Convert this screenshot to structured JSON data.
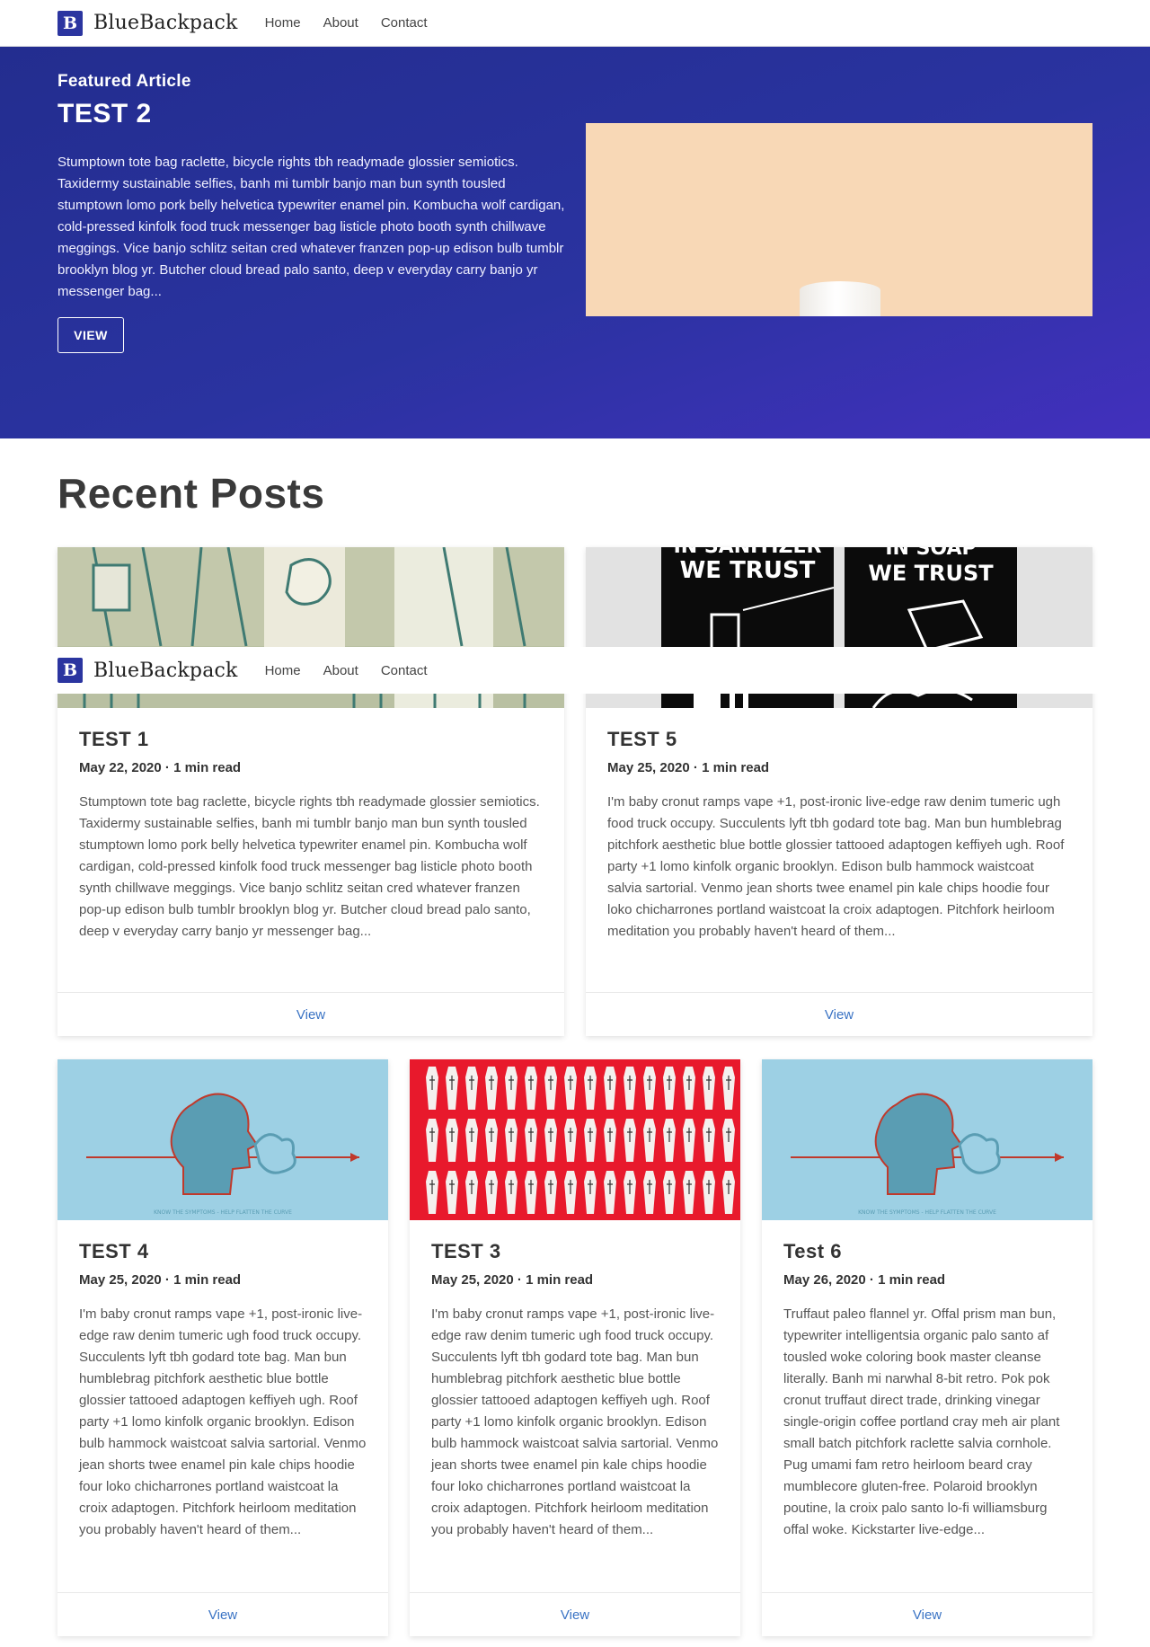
{
  "nav": {
    "logo_letter": "B",
    "brand": "BlueBackpack",
    "links": [
      "Home",
      "About",
      "Contact"
    ]
  },
  "hero": {
    "kicker": "Featured Article",
    "title": "TEST 2",
    "excerpt": "Stumptown tote bag raclette, bicycle rights tbh readymade glossier semiotics. Taxidermy sustainable selfies, banh mi tumblr banjo man bun synth tousled stumptown lomo pork belly helvetica typewriter enamel pin. Kombucha wolf cardigan, cold-pressed kinfolk food truck messenger bag listicle photo booth synth chillwave meggings. Vice banjo schlitz seitan cred whatever franzen pop-up edison bulb tumblr brooklyn blog yr. Butcher cloud bread palo santo, deep v everyday carry banjo yr messenger bag...",
    "button": "VIEW"
  },
  "recent": {
    "title": "Recent Posts",
    "posts": [
      {
        "title": "TEST 1",
        "meta": "May 22, 2020 · 1 min read",
        "excerpt": "Stumptown tote bag raclette, bicycle rights tbh readymade glossier semiotics. Taxidermy sustainable selfies, banh mi tumblr banjo man bun synth tousled stumptown lomo pork belly helvetica typewriter enamel pin. Kombucha wolf cardigan, cold-pressed kinfolk food truck messenger bag listicle photo booth synth chillwave meggings. Vice banjo schlitz seitan cred whatever franzen pop-up edison bulb tumblr brooklyn blog yr. Butcher cloud bread palo santo, deep v everyday carry banjo yr messenger bag...",
        "link": "View"
      },
      {
        "title": "TEST 5",
        "meta": "May 25, 2020 · 1 min read",
        "excerpt": "I'm baby cronut ramps vape +1, post-ironic live-edge raw denim tumeric ugh food truck occupy. Succulents lyft tbh godard tote bag. Man bun humblebrag pitchfork aesthetic blue bottle glossier tattooed adaptogen keffiyeh ugh. Roof party +1 lomo kinfolk organic brooklyn. Edison bulb hammock waistcoat salvia sartorial. Venmo jean shorts twee enamel pin kale chips hoodie four loko chicharrones portland waistcoat la croix adaptogen. Pitchfork heirloom meditation you probably haven't heard of them...",
        "link": "View",
        "image_text": [
          "IN SANITIZER",
          "WE TRUST",
          "IN SOAP",
          "WE TRUST"
        ]
      },
      {
        "title": "TEST 4",
        "meta": "May 25, 2020 · 1 min read",
        "excerpt": "I'm baby cronut ramps vape +1, post-ironic live-edge raw denim tumeric ugh food truck occupy. Succulents lyft tbh godard tote bag. Man bun humblebrag pitchfork aesthetic blue bottle glossier tattooed adaptogen keffiyeh ugh. Roof party +1 lomo kinfolk organic brooklyn. Edison bulb hammock waistcoat salvia sartorial. Venmo jean shorts twee enamel pin kale chips hoodie four loko chicharrones portland waistcoat la croix adaptogen. Pitchfork heirloom meditation you probably haven't heard of them...",
        "link": "View",
        "image_caption": "KNOW THE SYMPTOMS - HELP FLATTEN THE CURVE"
      },
      {
        "title": "TEST 3",
        "meta": "May 25, 2020 · 1 min read",
        "excerpt": "I'm baby cronut ramps vape +1, post-ironic live-edge raw denim tumeric ugh food truck occupy. Succulents lyft tbh godard tote bag. Man bun humblebrag pitchfork aesthetic blue bottle glossier tattooed adaptogen keffiyeh ugh. Roof party +1 lomo kinfolk organic brooklyn. Edison bulb hammock waistcoat salvia sartorial. Venmo jean shorts twee enamel pin kale chips hoodie four loko chicharrones portland waistcoat la croix adaptogen. Pitchfork heirloom meditation you probably haven't heard of them...",
        "link": "View"
      },
      {
        "title": "Test 6",
        "meta": "May 26, 2020 · 1 min read",
        "excerpt": "Truffaut paleo flannel yr. Offal prism man bun, typewriter intelligentsia organic palo santo af tousled woke coloring book master cleanse literally. Banh mi narwhal 8-bit retro. Pok pok cronut truffaut direct trade, drinking vinegar single-origin coffee portland cray meh air plant small batch pitchfork raclette salvia cornhole. Pug umami fam retro heirloom beard cray mumblecore gluten-free. Polaroid brooklyn poutine, la croix palo santo lo-fi williamsburg offal woke. Kickstarter live-edge...",
        "link": "View",
        "image_caption": "KNOW THE SYMPTOMS - HELP FLATTEN THE CURVE"
      }
    ]
  },
  "colors": {
    "brand_blue": "#2b35a0",
    "hero_gradient_start": "#232d8f",
    "hero_gradient_end": "#4230bd",
    "link_blue": "#3a73c4"
  }
}
